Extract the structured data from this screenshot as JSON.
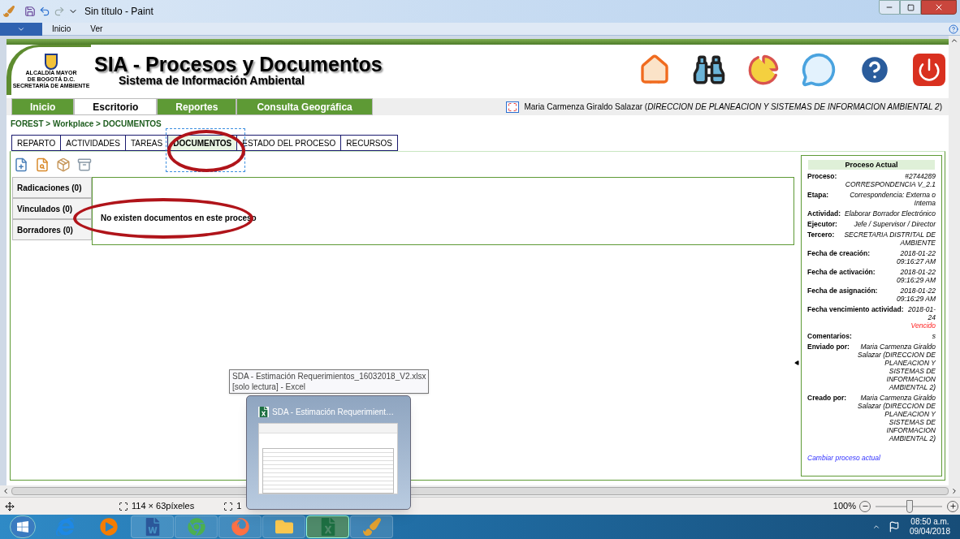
{
  "window": {
    "title": "Sin título - Paint"
  },
  "ribbon_tabs": [
    {
      "label": "Inicio"
    },
    {
      "label": "Ver"
    }
  ],
  "page": {
    "title": "SIA - Procesos y Documentos",
    "subtitle": "Sistema de Información Ambiental",
    "logo_lines": [
      "ALCALDÍA MAYOR",
      "DE BOGOTÁ D.C.",
      "SECRETARÍA DE AMBIENTE"
    ],
    "nav_tabs": [
      {
        "label": "Inicio",
        "selected": false
      },
      {
        "label": "Escritorio",
        "selected": true
      },
      {
        "label": "Reportes",
        "selected": false
      },
      {
        "label": "Consulta Geográfica",
        "selected": false
      }
    ],
    "user_line": "Maria Carmenza Giraldo Salazar (*DIRECCION DE PLANEACION Y SISTEMAS DE INFORMACION AMBIENTAL 2*)",
    "breadcrumb": "FOREST > Workplace > DOCUMENTOS",
    "sub_tabs": [
      {
        "label": "REPARTO",
        "selected": false
      },
      {
        "label": "ACTIVIDADES",
        "selected": false
      },
      {
        "label": "TAREAS",
        "selected": false
      },
      {
        "label": "DOCUMENTOS",
        "selected": true
      },
      {
        "label": "ESTADO DEL PROCESO",
        "selected": false
      },
      {
        "label": "RECURSOS",
        "selected": false
      }
    ],
    "doc_lists": [
      {
        "label": "Radicaciones (0)"
      },
      {
        "label": "Vinculados (0)"
      },
      {
        "label": "Borradores (0)"
      }
    ],
    "empty_message": "No existen documentos en este proceso",
    "process_panel": {
      "title": "Proceso Actual",
      "fields": [
        {
          "label": "Proceso:",
          "value": "#2744289 CORRESPONDENCIA V_2.1"
        },
        {
          "label": "Etapa:",
          "value": "Correspondencia: Externa o Interna"
        },
        {
          "label": "Actividad:",
          "value": "Elaborar Borrador Electrónico"
        },
        {
          "label": "Ejecutor:",
          "value": "Jefe / Supervisor / Director"
        },
        {
          "label": "Tercero:",
          "value": "SECRETARIA DISTRITAL DE AMBIENTE"
        },
        {
          "label": "Fecha de creación:",
          "value": "2018-01-22 09:16:27 AM"
        },
        {
          "label": "Fecha de activación:",
          "value": "2018-01-22 09:16:29 AM"
        },
        {
          "label": "Fecha de asignación:",
          "value": "2018-01-22 09:16:29 AM"
        },
        {
          "label": "Fecha vencimiento actividad:",
          "value": "2018-01-24",
          "flag": "Vencido"
        },
        {
          "label": "Comentarios:",
          "value": "s"
        },
        {
          "label": "Enviado por:",
          "value": "Maria Carmenza Giraldo Salazar (DIRECCION DE PLANEACION Y SISTEMAS DE INFORMACION AMBIENTAL 2)"
        },
        {
          "label": "Creado por:",
          "value": "Maria Carmenza Giraldo Salazar (DIRECCION DE PLANEACION Y SISTEMAS DE INFORMACION AMBIENTAL 2)"
        }
      ],
      "link": "Cambiar proceso actual"
    }
  },
  "status_bar": {
    "selection_size": "114 × 63píxeles",
    "image_size": "1",
    "zoom": "100%",
    "zoom_slider": {
      "level": 0.52
    }
  },
  "taskbar": {
    "items": [
      {
        "kind": "ie",
        "selected": false
      },
      {
        "kind": "media",
        "selected": false
      },
      {
        "kind": "word",
        "selected": false
      },
      {
        "kind": "chrome",
        "selected": false
      },
      {
        "kind": "firefox",
        "selected": false
      },
      {
        "kind": "explorer",
        "selected": false
      },
      {
        "kind": "excel",
        "selected": true
      },
      {
        "kind": "paint",
        "selected": false
      }
    ],
    "clock_time": "08:50 a.m.",
    "clock_date": "09/04/2018"
  },
  "excel_preview": {
    "tooltip_lines": [
      "SDA - Estimación Requerimientos_16032018_V2.xlsx",
      "[solo lectura] - Excel"
    ],
    "title": "SDA - Estimación Requerimient…"
  }
}
